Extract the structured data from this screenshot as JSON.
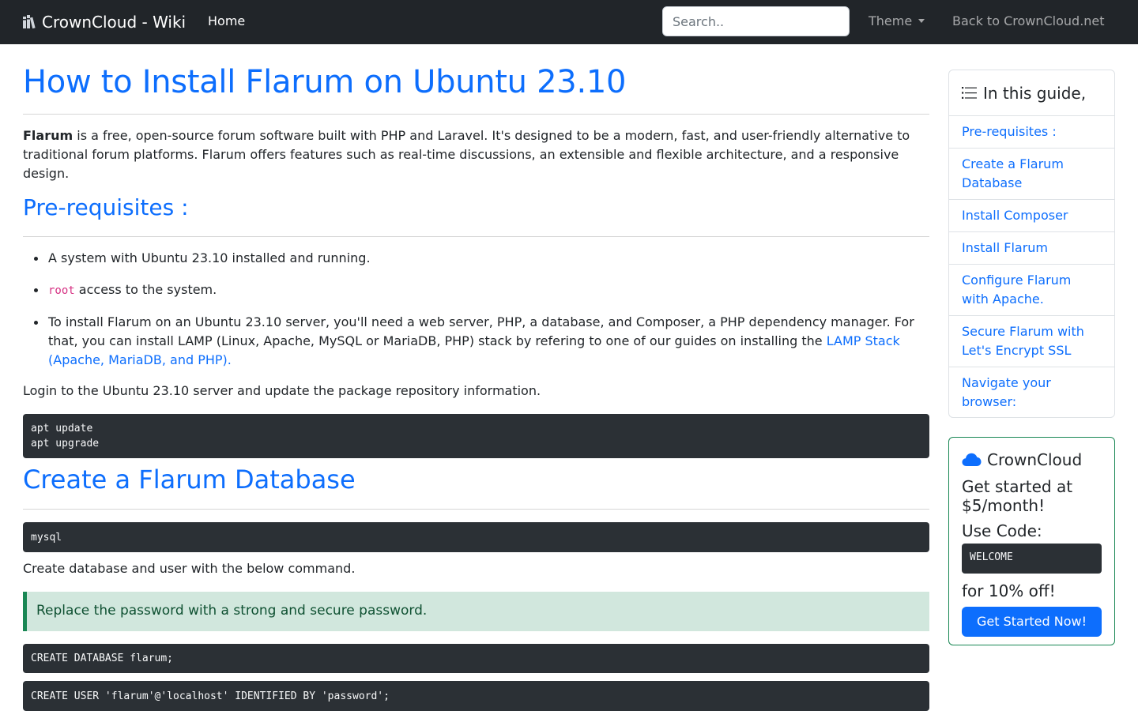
{
  "navbar": {
    "brand": "CrownCloud - Wiki",
    "brand_icon": "books-icon",
    "home": "Home",
    "search_placeholder": "Search..",
    "theme": "Theme",
    "back": "Back to CrownCloud.net"
  },
  "article": {
    "title": "How to Install Flarum on Ubuntu 23.10",
    "intro_bold": "Flarum",
    "intro_text": " is a free, open-source forum software built with PHP and Laravel. It's designed to be a modern, fast, and user-friendly alternative to traditional forum platforms. Flarum offers features such as real-time discussions, an extensible and flexible architecture, and a responsive design.",
    "prereq_heading": "Pre-requisites :",
    "prereq_items": {
      "item1": "A system with Ubuntu 23.10 installed and running.",
      "item2_code": "root",
      "item2_text": " access to the system.",
      "item3_text": "To install Flarum on an Ubuntu 23.10 server, you'll need a web server, PHP, a database, and Composer, a PHP dependency manager. For that, you can install LAMP (Linux, Apache, MySQL or MariaDB, PHP) stack by refering to one of our guides on installing the ",
      "item3_link": "LAMP Stack (Apache, MariaDB, and PHP).",
      "item3_tail": ""
    },
    "login_text": "Login to the Ubuntu 23.10 server and update the package repository information.",
    "code_update": "apt update\napt upgrade",
    "db_heading": "Create a Flarum Database",
    "code_mysql": "mysql",
    "db_text": "Create database and user with the below command.",
    "note": "Replace the password with a strong and secure password.",
    "code_create_db": "CREATE DATABASE flarum;",
    "code_create_user": "CREATE USER 'flarum'@'localhost' IDENTIFIED BY 'password';"
  },
  "toc": {
    "heading": "In this guide,",
    "items": [
      "Pre-requisites :",
      "Create a Flarum Database",
      "Install Composer",
      "Install Flarum",
      "Configure Flarum with Apache.",
      "Secure Flarum with Let's Encrypt SSL",
      "Navigate your browser:"
    ]
  },
  "promo": {
    "title": "CrownCloud",
    "line1": "Get started at $5/month!",
    "line2": "Use Code:",
    "code": "WELCOME",
    "line3": "for 10% off!",
    "button": "Get Started Now!"
  },
  "colors": {
    "navbar_bg": "#212529",
    "link": "#0d6efd",
    "code_bg": "#2b3035",
    "note_bg": "#d1e7dd",
    "note_border": "#198754",
    "promo_border": "#198754"
  }
}
